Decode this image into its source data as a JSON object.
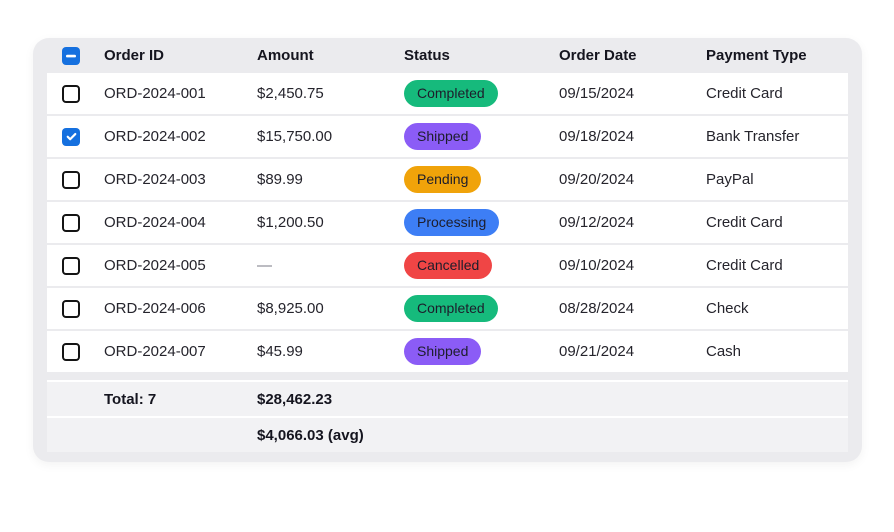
{
  "table": {
    "select_all_state": "indeterminate",
    "accent_color": "#1570df",
    "columns": [
      "Order ID",
      "Amount",
      "Status",
      "Order Date",
      "Payment Type"
    ],
    "rows": [
      {
        "checked": false,
        "order_id": "ORD-2024-001",
        "amount": "$2,450.75",
        "status": "Completed",
        "order_date": "09/15/2024",
        "payment_type": "Credit Card"
      },
      {
        "checked": true,
        "order_id": "ORD-2024-002",
        "amount": "$15,750.00",
        "status": "Shipped",
        "order_date": "09/18/2024",
        "payment_type": "Bank Transfer"
      },
      {
        "checked": false,
        "order_id": "ORD-2024-003",
        "amount": "$89.99",
        "status": "Pending",
        "order_date": "09/20/2024",
        "payment_type": "PayPal"
      },
      {
        "checked": false,
        "order_id": "ORD-2024-004",
        "amount": "$1,200.50",
        "status": "Processing",
        "order_date": "09/12/2024",
        "payment_type": "Credit Card"
      },
      {
        "checked": false,
        "order_id": "ORD-2024-005",
        "amount": "—",
        "status": "Cancelled",
        "order_date": "09/10/2024",
        "payment_type": "Credit Card"
      },
      {
        "checked": false,
        "order_id": "ORD-2024-006",
        "amount": "$8,925.00",
        "status": "Completed",
        "order_date": "08/28/2024",
        "payment_type": "Check"
      },
      {
        "checked": false,
        "order_id": "ORD-2024-007",
        "amount": "$45.99",
        "status": "Shipped",
        "order_date": "09/21/2024",
        "payment_type": "Cash"
      }
    ],
    "status_colors": {
      "Completed": "#16ba7c",
      "Shipped": "#8b5cf6",
      "Pending": "#f0a30a",
      "Processing": "#3d7ef5",
      "Cancelled": "#f04545"
    },
    "footer": {
      "total_label": "Total: 7",
      "total_amount": "$28,462.23",
      "avg_amount": "$4,066.03 (avg)"
    }
  }
}
